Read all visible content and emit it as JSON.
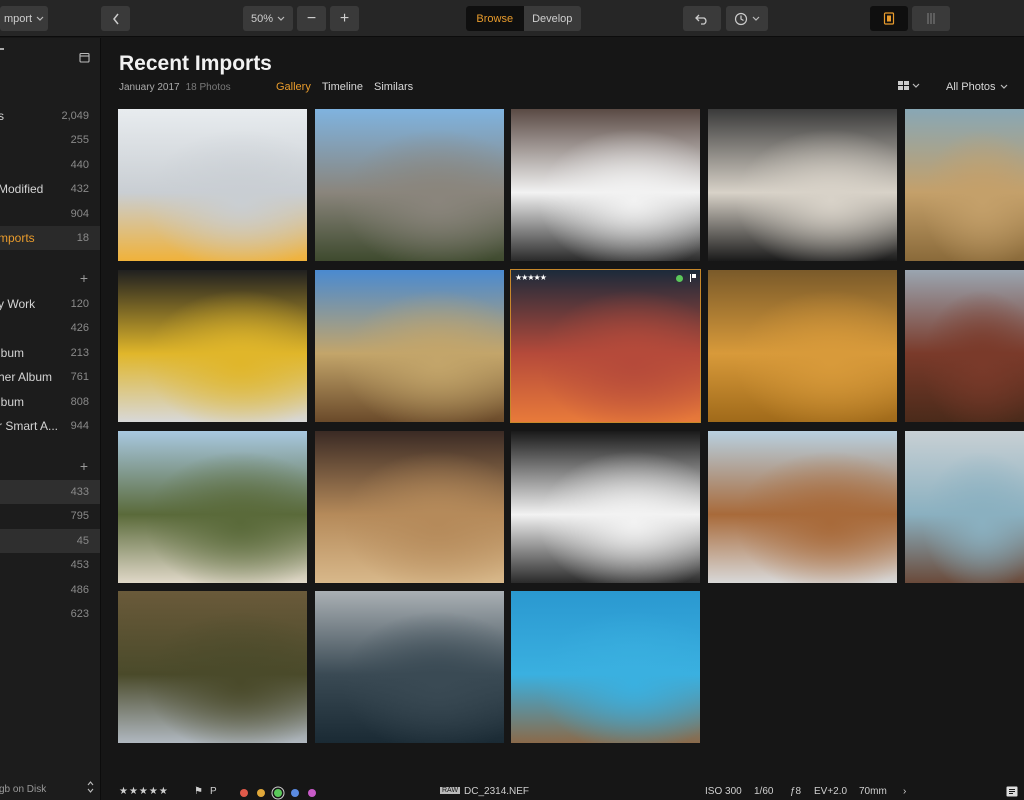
{
  "toolbar": {
    "import_label": "mport",
    "zoom_label": "50%",
    "minus_label": "−",
    "plus_label": "+",
    "browse_label": "Browse",
    "develop_label": "Develop",
    "accent_color": "#e89b2c"
  },
  "sidebar": {
    "top_rows": [
      {
        "label": "s",
        "count": "2,049"
      },
      {
        "label": "",
        "count": "255"
      },
      {
        "label": "",
        "count": "440"
      },
      {
        "label": "Modified",
        "count": "432"
      },
      {
        "label": "",
        "count": "904"
      },
      {
        "label": "mports",
        "count": "18"
      }
    ],
    "album_rows": [
      {
        "label": "y Work",
        "count": "120"
      },
      {
        "label": "",
        "count": "426"
      },
      {
        "label": "lbum",
        "count": "213"
      },
      {
        "label": "her Album",
        "count": "761"
      },
      {
        "label": "lbum",
        "count": "808"
      },
      {
        "label": "r Smart A...",
        "count": "944"
      }
    ],
    "folder_rows": [
      {
        "label": "",
        "count": "433"
      },
      {
        "label": "",
        "count": "795"
      },
      {
        "label": "",
        "count": "45"
      },
      {
        "label": "",
        "count": "453"
      },
      {
        "label": "",
        "count": "486"
      },
      {
        "label": "",
        "count": "623"
      }
    ],
    "plus_label": "+",
    "footer_label": "gb on Disk"
  },
  "main": {
    "title": "Recent Imports",
    "date": "January 2017",
    "photo_count": "18 Photos",
    "tabs": [
      "Gallery",
      "Timeline",
      "Similars"
    ],
    "filter_label": "All Photos",
    "selected_rating": "★★★★★"
  },
  "photos": [
    {
      "name": "photo-airplane-wing",
      "colors": [
        "#e8ecef",
        "#c9ced3",
        "#f0b23a"
      ]
    },
    {
      "name": "photo-bridge-overpass",
      "colors": [
        "#7fb3df",
        "#8a857c",
        "#3e4a2e"
      ]
    },
    {
      "name": "photo-white-car",
      "colors": [
        "#5a4a44",
        "#f2f2f2",
        "#2a2a2a"
      ]
    },
    {
      "name": "photo-train-crowd",
      "colors": [
        "#3a3a3a",
        "#d8d2c8",
        "#1a1a1a"
      ]
    },
    {
      "name": "photo-desert-road",
      "colors": [
        "#88a7b5",
        "#c4a06a",
        "#8a6a3a"
      ]
    },
    {
      "name": "photo-yellow-train",
      "colors": [
        "#202020",
        "#e0b62a",
        "#d8d8d8"
      ]
    },
    {
      "name": "photo-brooklyn-bridge",
      "colors": [
        "#4a8ad0",
        "#c3a56a",
        "#6a4a2a"
      ]
    },
    {
      "name": "photo-cinque-terre",
      "colors": [
        "#1c2a3a",
        "#b54a3a",
        "#e87a3a"
      ]
    },
    {
      "name": "photo-sand-dunes",
      "colors": [
        "#7a5a2a",
        "#d89a3a",
        "#a06a1a"
      ]
    },
    {
      "name": "photo-brick-canal",
      "colors": [
        "#9aa5b0",
        "#7a3a2a",
        "#4a2a1a"
      ]
    },
    {
      "name": "photo-car-window-girl",
      "colors": [
        "#a8c8e0",
        "#5a6a3a",
        "#e0d8c8"
      ]
    },
    {
      "name": "photo-globe-hand",
      "colors": [
        "#3a2a24",
        "#b58a5a",
        "#d8b88a"
      ]
    },
    {
      "name": "photo-skyscrapers",
      "colors": [
        "#1a1a1a",
        "#f2f2f2",
        "#2a2a2a"
      ]
    },
    {
      "name": "photo-suspension-bridge",
      "colors": [
        "#b8d0e0",
        "#a86a3a",
        "#d8d8d8"
      ]
    },
    {
      "name": "photo-map-coffee",
      "colors": [
        "#c8d0d4",
        "#8ab0c0",
        "#6a4a3a"
      ]
    },
    {
      "name": "photo-forest-hiker",
      "colors": [
        "#6a5a3a",
        "#4a4a2a",
        "#b0b8c0"
      ]
    },
    {
      "name": "photo-ocean-water",
      "colors": [
        "#aab0b4",
        "#3a4a54",
        "#1a2a34"
      ]
    },
    {
      "name": "photo-coast-aerial",
      "colors": [
        "#2a98d0",
        "#3ab0e0",
        "#8a6a4a"
      ]
    }
  ],
  "bottom": {
    "rating": "★★★★★",
    "flag1": "⚑",
    "flag2": "P",
    "label_colors": [
      "#e05a4a",
      "#e0a83a",
      "#5ac85a",
      "#5a8ae0",
      "#c85ac8"
    ],
    "raw_badge": "RAW",
    "filename": "DC_2314.NEF",
    "iso": "ISO 300",
    "shutter": "1/60",
    "aperture": "ƒ8",
    "ev": "EV+2.0",
    "focal": "70mm",
    "more": "›"
  }
}
